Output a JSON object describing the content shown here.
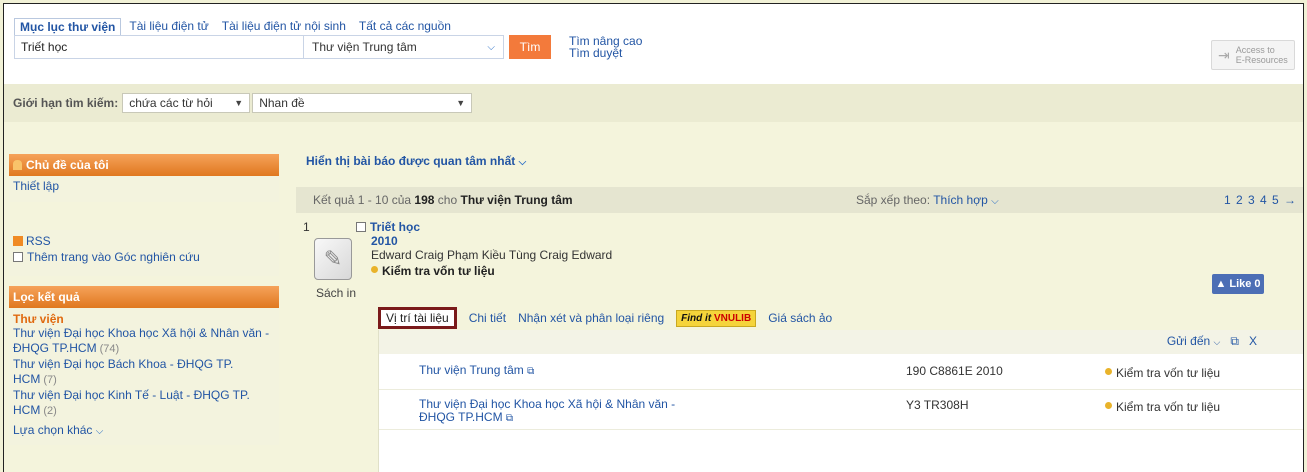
{
  "tabs": [
    {
      "label": "Mục lục thư viện",
      "active": true
    },
    {
      "label": "Tài liệu điện tử",
      "active": false
    },
    {
      "label": "Tài liệu điện tử nội sinh",
      "active": false
    },
    {
      "label": "Tất cả các nguồn",
      "active": false
    }
  ],
  "search": {
    "query": "Triết học",
    "library": "Thư viện Trung tâm",
    "button": "Tìm",
    "advanced": "Tìm nâng cao",
    "browse": "Tìm duyệt"
  },
  "access": {
    "line1": "Access to",
    "line2": "E-Resources"
  },
  "limit": {
    "label": "Giới hạn tìm kiếm:",
    "mode": "chứa các từ hỏi",
    "field": "Nhan đề"
  },
  "sidebar": {
    "my_topics": "Chủ đề của tôi",
    "setup": "Thiết lập",
    "rss": "RSS",
    "add_corner": "Thêm trang vào Góc nghiên cứu",
    "filter_head": "Lọc kết quả",
    "facet_title": "Thư viện",
    "facets": [
      {
        "label": "Thư viện Đại học Khoa học Xã hội & Nhân văn - ĐHQG TP.HCM",
        "count": "(74)"
      },
      {
        "label": "Thư viện Đại học Bách Khoa - ĐHQG TP. HCM",
        "count": "(7)"
      },
      {
        "label": "Thư viện Đại học Kinh Tế - Luật - ĐHQG TP. HCM",
        "count": "(2)"
      }
    ],
    "more": "Lựa chọn khác"
  },
  "main": {
    "featured": "Hiển thị bài báo được quan tâm nhất",
    "results_prefix": "Kết quả 1 - 10 của",
    "results_total": "198",
    "results_for": "cho",
    "results_library": "Thư viện Trung tâm",
    "sort_label": "Sắp xếp theo:",
    "sort_value": "Thích hợp",
    "pages": "1 2 3 4 5"
  },
  "record": {
    "number": "1",
    "title": "Triết học",
    "year": "2010",
    "author": "Edward Craig Phạm Kiều Tùng Craig Edward",
    "availability": "Kiểm tra vốn tư liệu",
    "format": "Sách in",
    "like": "Like 0",
    "tabs": [
      "Vị trí tài liệu",
      "Chi tiết",
      "Nhận xét và phân loại riêng"
    ],
    "findit": "Find it",
    "findit_brand": "VNULIB",
    "virtual_shelf": "Giá sách ảo",
    "send_to": "Gửi đến",
    "close": "X"
  },
  "holdings": [
    {
      "location": "Thư viện Trung tâm",
      "call": "190 C8861E 2010",
      "status": "Kiểm tra vốn tư liệu"
    },
    {
      "location": "Thư viện Đại học Khoa học Xã hội & Nhân văn - ĐHQG TP.HCM",
      "call": "Y3 TR308H",
      "status": "Kiểm tra vốn tư liệu"
    }
  ],
  "colors": {
    "accent": "#f37a3b",
    "link": "#2255a4",
    "highlight_border": "#7a1a1a"
  }
}
